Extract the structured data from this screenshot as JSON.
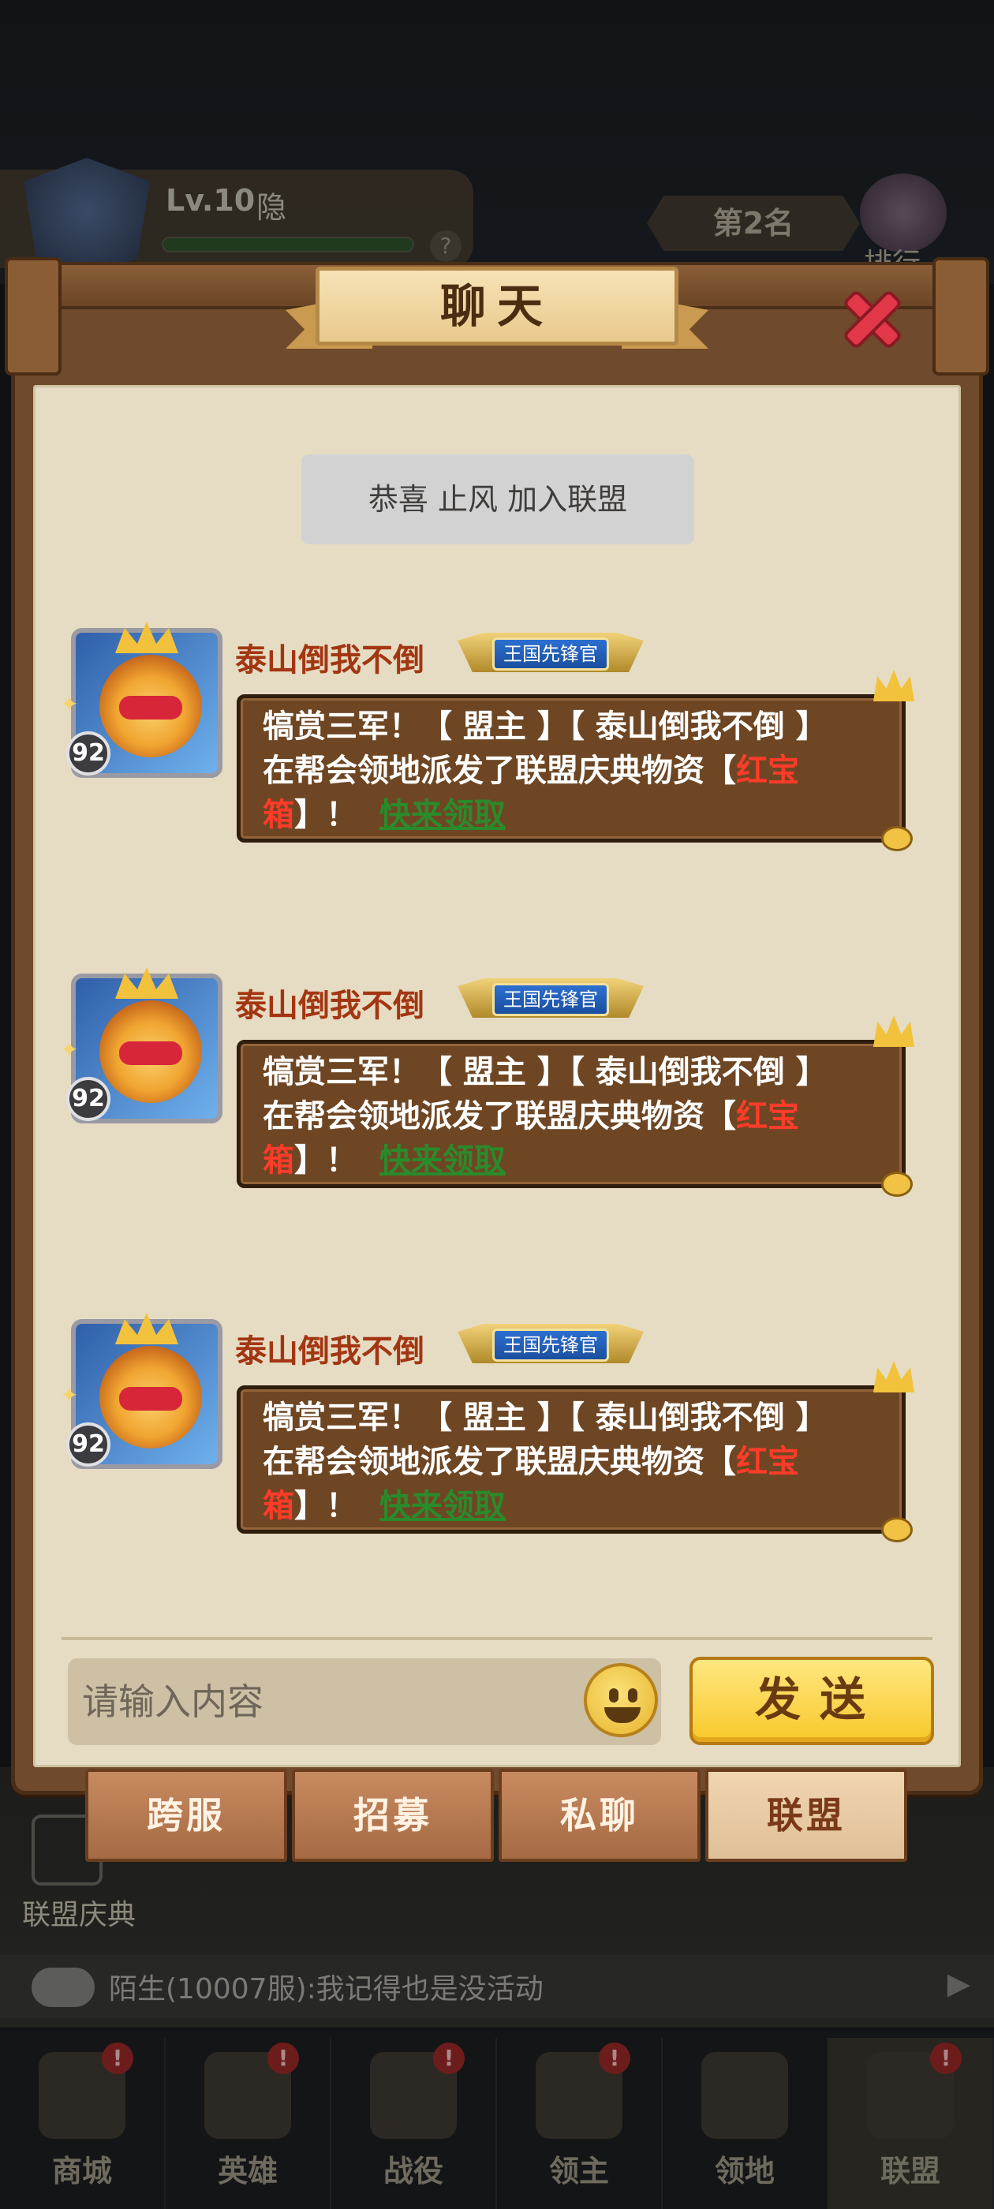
{
  "background": {
    "player": {
      "level": "Lv.10",
      "status": "隐",
      "help": "?"
    },
    "rank": {
      "label": "第2名",
      "button": "排行"
    },
    "celebration": "联盟庆典",
    "ticker": {
      "text": "陌生(10007服):我记得也是没活动",
      "arrow": "▶"
    },
    "nav": [
      {
        "label": "商城",
        "badge": "!"
      },
      {
        "label": "英雄",
        "badge": "!"
      },
      {
        "label": "战役",
        "badge": "!"
      },
      {
        "label": "领主",
        "badge": "!"
      },
      {
        "label": "领地",
        "badge": ""
      },
      {
        "label": "联盟",
        "badge": "!"
      }
    ]
  },
  "dialog": {
    "title": "聊天",
    "system_notice": "恭喜 止风 加入联盟",
    "messages": [
      {
        "sender": "泰山倒我不倒",
        "title_badge": "王国先锋官",
        "level": "92",
        "line1": "犒赏三军！【 盟主 】【 泰山倒我不倒 】",
        "line2_prefix": "在帮会领地派发了联盟庆典物资【",
        "item_part1": "红宝",
        "item_part2": "箱",
        "line3_suffix": "】！",
        "action": "快来领取"
      },
      {
        "sender": "泰山倒我不倒",
        "title_badge": "王国先锋官",
        "level": "92",
        "line1": "犒赏三军！【 盟主 】【 泰山倒我不倒 】",
        "line2_prefix": "在帮会领地派发了联盟庆典物资【",
        "item_part1": "红宝",
        "item_part2": "箱",
        "line3_suffix": "】！",
        "action": "快来领取"
      },
      {
        "sender": "泰山倒我不倒",
        "title_badge": "王国先锋官",
        "level": "92",
        "line1": "犒赏三军！【 盟主 】【 泰山倒我不倒 】",
        "line2_prefix": "在帮会领地派发了联盟庆典物资【",
        "item_part1": "红宝",
        "item_part2": "箱",
        "line3_suffix": "】！",
        "action": "快来领取"
      }
    ],
    "composer": {
      "placeholder": "请输入内容",
      "send_label": "发送"
    },
    "tabs": [
      {
        "label": "跨服",
        "active": false
      },
      {
        "label": "招募",
        "active": false
      },
      {
        "label": "私聊",
        "active": false
      },
      {
        "label": "联盟",
        "active": true
      }
    ]
  },
  "colors": {
    "frame": "#6f4a2c",
    "parchment": "#e6dcc4",
    "bubble": "#6e4623",
    "sender": "#a33612",
    "highlight_red": "#ff3b2a",
    "action_green": "#2b8a2b",
    "send_button": "#f8c829",
    "close_icon": "#e2384a"
  },
  "icons": {
    "close": "close-icon",
    "emoji": "emoji-icon",
    "avatar": "monkey-king-avatar",
    "title_badge": "winged-badge-icon"
  }
}
